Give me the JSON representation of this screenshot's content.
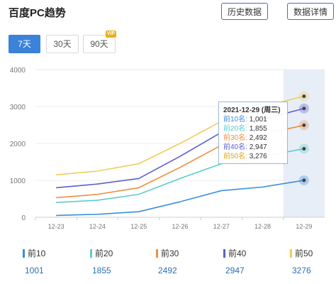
{
  "header": {
    "title": "百度PC趋势",
    "history_button": "历史数据",
    "detail_button": "数据详情"
  },
  "range_tabs": [
    {
      "label": "7天",
      "active": true
    },
    {
      "label": "30天",
      "active": false
    },
    {
      "label": "90天",
      "active": false,
      "badge": "VIP"
    }
  ],
  "colors": {
    "accent": "#3b82d9",
    "top10": "#3a8ee0",
    "top20": "#5ccccc",
    "top30": "#ef8d3e",
    "top40": "#5b5fcf",
    "top50": "#f2cc5a",
    "highlight_band": "#e8eef8"
  },
  "chart_data": {
    "type": "line",
    "categories": [
      "12-23",
      "12-24",
      "12-25",
      "12-26",
      "12-27",
      "12-28",
      "12-29"
    ],
    "ylim": [
      0,
      4000
    ],
    "yticks": [
      "0",
      "1000",
      "2000",
      "3000",
      "4000"
    ],
    "grid": true,
    "highlighted_category": "12-29",
    "series": [
      {
        "name": "前10",
        "color": "#3a8ee0",
        "values": [
          50,
          80,
          150,
          420,
          720,
          820,
          1001
        ]
      },
      {
        "name": "前20",
        "color": "#5ccccc",
        "values": [
          400,
          460,
          620,
          1050,
          1450,
          1650,
          1855
        ]
      },
      {
        "name": "前30",
        "color": "#ef8d3e",
        "values": [
          530,
          620,
          800,
          1350,
          1950,
          2250,
          2492
        ]
      },
      {
        "name": "前40",
        "color": "#5b5fcf",
        "values": [
          800,
          900,
          1050,
          1650,
          2300,
          2650,
          2947
        ]
      },
      {
        "name": "前50",
        "color": "#f2cc5a",
        "values": [
          1150,
          1250,
          1450,
          2000,
          2600,
          3000,
          3276
        ]
      }
    ]
  },
  "tooltip": {
    "date": "2021-12-29 (周三)",
    "rows": [
      {
        "label": "前10名:",
        "value": "1,001"
      },
      {
        "label": "前20名:",
        "value": "1,855"
      },
      {
        "label": "前30名:",
        "value": "2,492"
      },
      {
        "label": "前40名:",
        "value": "2,947"
      },
      {
        "label": "前50名:",
        "value": "3,276"
      }
    ]
  },
  "legend": [
    {
      "label": "前10",
      "value": "1001",
      "color": "#3a8ee0"
    },
    {
      "label": "前20",
      "value": "1855",
      "color": "#5ccccc"
    },
    {
      "label": "前30",
      "value": "2492",
      "color": "#ef8d3e"
    },
    {
      "label": "前40",
      "value": "2947",
      "color": "#5b5fcf"
    },
    {
      "label": "前50",
      "value": "3276",
      "color": "#f2cc5a"
    }
  ]
}
